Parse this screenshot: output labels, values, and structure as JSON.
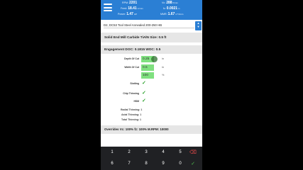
{
  "header": {
    "rpm": {
      "label": "RPM:",
      "value": "2201"
    },
    "feed": {
      "label": "Feed:",
      "value": "18.41",
      "unit": "in/min"
    },
    "power": {
      "label": "Power:",
      "value": "1.47",
      "unit": "HP"
    },
    "vc": {
      "label": "Vc:",
      "value": "288",
      "unit": "ft/min"
    },
    "fz": {
      "label": "fz:",
      "value": "0.0021",
      "unit": "in"
    },
    "mmr": {
      "label": "MMR:",
      "value": "1.67",
      "unit": "in^3/min"
    }
  },
  "material": {
    "value": "D2, DC53 Tool Steel Annealed 200-250 HB",
    "spinner_icon": "up-down-arrows"
  },
  "tool": {
    "label": "Solid End Mill Carbide TiAlN Size: 0.5 ft"
  },
  "engagement": {
    "title": "Engagement DOC: 0.1815 WOC: 0.5",
    "depth_of_cut": {
      "label": "Depth Of Cut",
      "value": "0.25",
      "unit": "in"
    },
    "width_of_cut": {
      "label": "Width Of Cut",
      "value": "0.5",
      "unit": "in"
    },
    "percent": {
      "value": "100",
      "unit": "%"
    },
    "slotting": {
      "label": "Slotting",
      "checked": true
    },
    "chip_thinning": {
      "label": "Chip Thinning",
      "checked": true
    },
    "hsm": {
      "label": "HSM",
      "checked": true
    },
    "radial_thinning": {
      "label": "Radial Thinning:",
      "value": "1"
    },
    "axial_thinning": {
      "label": "Axial Thinning:",
      "value": "1"
    },
    "total_thinning": {
      "label": "Total Thinning:",
      "value": "1"
    }
  },
  "overrides": {
    "label": "Overrides Vc: 100% fz: 100% M.RPM: 10000"
  },
  "keypad": {
    "keys": [
      "1",
      "2",
      "3",
      "4",
      "5",
      "6",
      "7",
      "8",
      "9",
      "0",
      ".",
      "-"
    ],
    "delete_icon": "backspace-icon",
    "go_icon": "check-icon"
  },
  "colors": {
    "accent": "#2b7fd4",
    "field": "#7fe07f",
    "check": "#2fa32f",
    "keypad_bg": "#202124"
  }
}
